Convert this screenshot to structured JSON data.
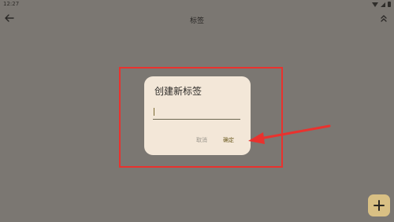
{
  "status_bar": {
    "time": "12:27"
  },
  "app_bar": {
    "title": "标签",
    "back_icon": "arrow-left-icon",
    "collapse_icon": "chevrons-up-icon"
  },
  "dialog": {
    "title": "创建新标签",
    "input_value": "",
    "cancel_label": "取消",
    "confirm_label": "确定"
  },
  "fab": {
    "icon": "plus-icon"
  },
  "colors": {
    "background": "#7b7772",
    "dialog_bg": "#f3e7d8",
    "annotation": "#e9322e",
    "fab_bg": "#d9c084",
    "confirm_text": "#6b5a1e"
  }
}
